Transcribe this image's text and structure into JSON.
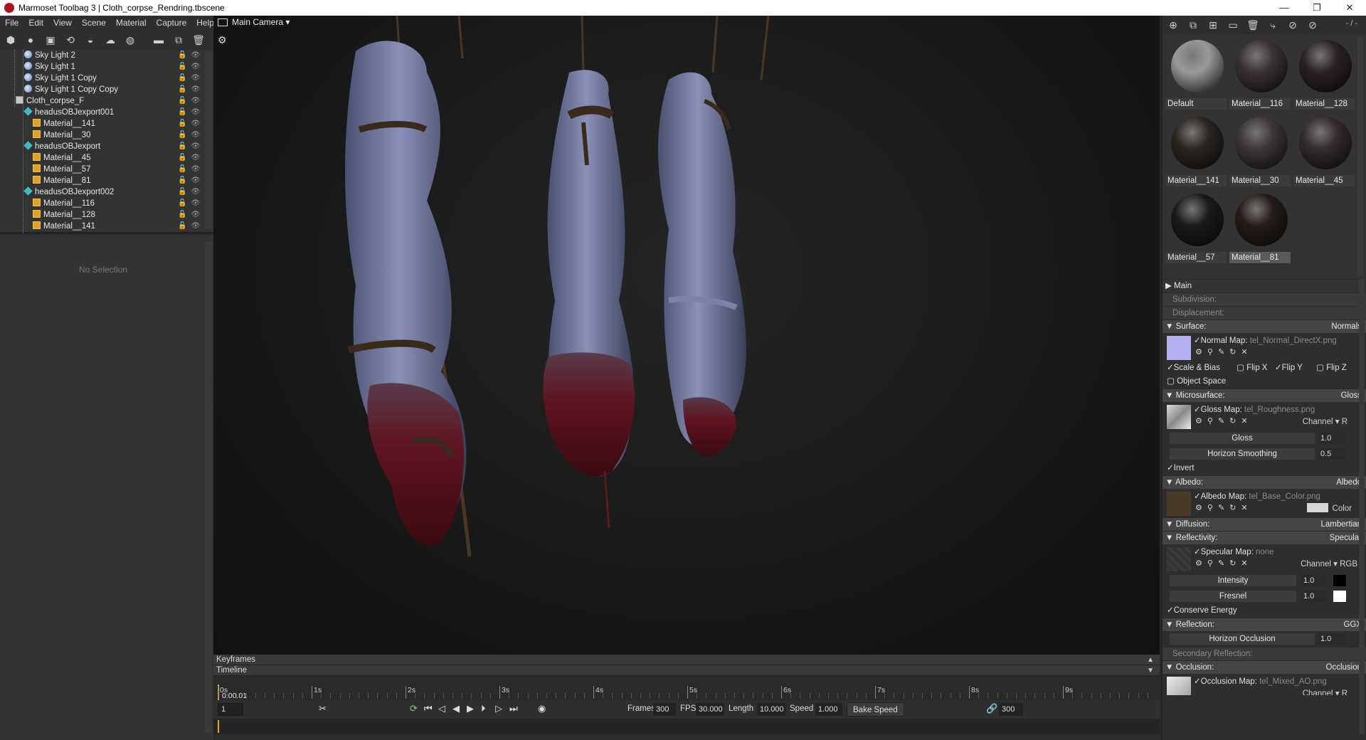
{
  "window": {
    "title": "Marmoset Toolbag 3  |  Cloth_corpse_Rendring.tbscene",
    "controls": [
      "—",
      "❐",
      "✕"
    ]
  },
  "menu": [
    "File",
    "Edit",
    "View",
    "Scene",
    "Material",
    "Capture",
    "Help"
  ],
  "outliner": {
    "items": [
      {
        "label": "Sky Light 2",
        "icon": "light-icon",
        "depth": 2
      },
      {
        "label": "Sky Light 1",
        "icon": "light-icon",
        "depth": 2
      },
      {
        "label": "Sky Light 1 Copy",
        "icon": "light-icon",
        "depth": 2
      },
      {
        "label": "Sky Light 1 Copy Copy",
        "icon": "light-icon",
        "depth": 2
      },
      {
        "label": "Cloth_corpse_F",
        "icon": "scene-object-icon",
        "depth": 1
      },
      {
        "label": "headusOBJexport001",
        "icon": "mesh-icon",
        "depth": 2
      },
      {
        "label": "Material__141",
        "icon": "material-icon",
        "depth": 3
      },
      {
        "label": "Material__30",
        "icon": "material-icon",
        "depth": 3
      },
      {
        "label": "headusOBJexport",
        "icon": "mesh-icon",
        "depth": 2
      },
      {
        "label": "Material__45",
        "icon": "material-icon",
        "depth": 3
      },
      {
        "label": "Material__57",
        "icon": "material-icon",
        "depth": 3
      },
      {
        "label": "Material__81",
        "icon": "material-icon",
        "depth": 3
      },
      {
        "label": "headusOBJexport002",
        "icon": "mesh-icon",
        "depth": 2
      },
      {
        "label": "Material__116",
        "icon": "material-icon",
        "depth": 3
      },
      {
        "label": "Material__128",
        "icon": "material-icon",
        "depth": 3
      },
      {
        "label": "Material__141",
        "icon": "material-icon",
        "depth": 3
      }
    ]
  },
  "selection": {
    "empty_label": "No Selection"
  },
  "viewport": {
    "camera_label": "Main Camera ▾"
  },
  "timeline": {
    "keyframes_label": "Keyframes",
    "timeline_label": "Timeline",
    "ticks": [
      "0s",
      "1s",
      "2s",
      "3s",
      "4s",
      "5s",
      "6s",
      "7s",
      "8s",
      "9s"
    ],
    "current_time": "0:00.01",
    "current_frame": "1",
    "frames_label": "Frames",
    "frames": "300",
    "fps_label": "FPS",
    "fps": "30.000",
    "length_label": "Length",
    "length": "10.000",
    "speed_label": "Speed",
    "speed": "1.000",
    "bake_speed_label": "Bake Speed",
    "end_frame": "300"
  },
  "materials": {
    "page": "- / -",
    "items": [
      {
        "name": "Default",
        "swatch": "#9a9a9a"
      },
      {
        "name": "Material__116",
        "swatch": "#3a3235"
      },
      {
        "name": "Material__128",
        "swatch": "#2a2224"
      },
      {
        "name": "Material__141",
        "swatch": "#2b2520"
      },
      {
        "name": "Material__30",
        "swatch": "#3c3638"
      },
      {
        "name": "Material__45",
        "swatch": "#332b2d"
      },
      {
        "name": "Material__57",
        "swatch": "#1a1a1c"
      },
      {
        "name": "Material__81",
        "swatch": "#241c18",
        "selected": true
      }
    ]
  },
  "properties": {
    "main": "Main",
    "subdivision": {
      "label": "Subdivision:",
      "value": "-"
    },
    "displacement": {
      "label": "Displacement:",
      "value": "-"
    },
    "surface": {
      "label": "Surface:",
      "mode": "Normals"
    },
    "normal_map": {
      "label": "Normal Map:",
      "file": "tel_Normal_DirectX.png"
    },
    "scale_bias": "Scale & Bias",
    "flip_x": "Flip X",
    "flip_y": "Flip Y",
    "flip_z": "Flip Z",
    "object_space": "Object Space",
    "microsurface": {
      "label": "Microsurface:",
      "mode": "Gloss"
    },
    "gloss_map": {
      "label": "Gloss Map:",
      "file": "tel_Roughness.png",
      "channel": "Channel ▾ R"
    },
    "gloss": {
      "label": "Gloss",
      "value": "1.0"
    },
    "horizon_smoothing": {
      "label": "Horizon Smoothing",
      "value": "0.5"
    },
    "invert": "Invert",
    "albedo": {
      "label": "Albedo:",
      "mode": "Albedo"
    },
    "albedo_map": {
      "label": "Albedo Map:",
      "file": "tel_Base_Color.png",
      "color_label": "Color"
    },
    "diffusion": {
      "label": "Diffusion:",
      "mode": "Lambertian"
    },
    "reflectivity": {
      "label": "Reflectivity:",
      "mode": "Specular"
    },
    "specular_map": {
      "label": "Specular Map:",
      "file": "none",
      "channel": "Channel ▾ RGB"
    },
    "intensity": {
      "label": "Intensity",
      "value": "1.0"
    },
    "fresnel": {
      "label": "Fresnel",
      "value": "1.0"
    },
    "conserve_energy": "Conserve Energy",
    "reflection": {
      "label": "Reflection:",
      "mode": "GGX"
    },
    "horizon_occlusion": {
      "label": "Horizon Occlusion",
      "value": "1.0"
    },
    "secondary_reflection": {
      "label": "Secondary Reflection:",
      "value": "-"
    },
    "occlusion": {
      "label": "Occlusion:",
      "mode": "Occlusion"
    },
    "occlusion_map": {
      "label": "Occlusion Map:",
      "file": "tel_Mixed_AO.png",
      "channel": "Channel ▾ R"
    }
  }
}
